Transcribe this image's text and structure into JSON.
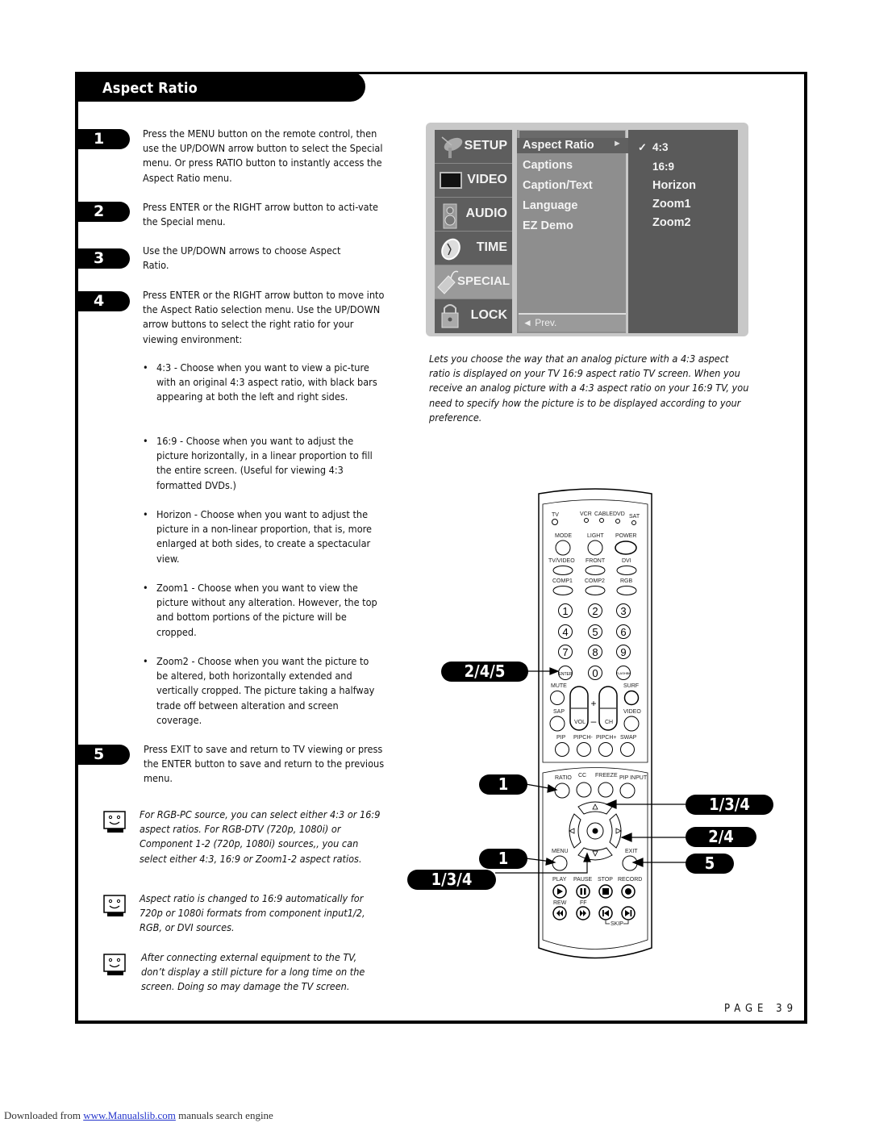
{
  "section_title": "Aspect Ratio",
  "steps": [
    {
      "number": "1",
      "text": "Press the MENU button on the remote control, then use the UP/DOWN arrow button to select the Special menu. Or press RATIO button to instantly access the Aspect Ratio menu."
    },
    {
      "number": "2",
      "text": "Press ENTER or the RIGHT arrow button to acti-vate the Special menu."
    },
    {
      "number": "3",
      "text": "Use the UP/DOWN arrows to choose Aspect Ratio."
    },
    {
      "number": "4",
      "text": "Press ENTER or the RIGHT arrow button to move into the Aspect Ratio selection menu. Use the UP/DOWN arrow buttons to select the right ratio for your viewing environment:"
    },
    {
      "number": "5",
      "text": "Press EXIT to save and return to TV viewing or press the ENTER button to save and return to the previous menu."
    }
  ],
  "bullets": [
    "4:3 - Choose when you want to view a pic-ture with an original 4:3 aspect ratio, with black bars appearing at both the left and right sides.",
    "16:9 - Choose when you want to adjust the picture horizontally, in a linear proportion to fill the entire screen. (Useful for viewing 4:3 formatted DVDs.)",
    "Horizon - Choose when you want to adjust the picture in a non-linear proportion, that is, more enlarged at both sides, to create a spectacular view.",
    "Zoom1 - Choose when you want to view the picture without any alteration. However, the top and bottom portions of the picture will be cropped.",
    "Zoom2 - Choose when you want the picture to be altered, both horizontally extended and vertically cropped. The picture taking a halfway trade off between alteration and screen coverage."
  ],
  "bullet_symbol": "•",
  "notes": [
    "For RGB-PC source, you can select either 4:3 or 16:9 aspect ratios. For RGB-DTV (720p, 1080i) or Component 1-2 (720p, 1080i) sources,, you can select either 4:3, 16:9 or Zoom1-2 aspect ratios.",
    "Aspect ratio is changed to 16:9 automatically for 720p or 1080i formats from component input1/2, RGB, or DVI sources.",
    "After connecting external equipment to the TV, don’t display a still picture for a long time on the screen. Doing so may damage the TV screen."
  ],
  "osd": {
    "main_menu": [
      {
        "label": "SETUP",
        "icon": "satellite-dish-icon"
      },
      {
        "label": "VIDEO",
        "icon": "tv-screen-icon"
      },
      {
        "label": "AUDIO",
        "icon": "speaker-icon"
      },
      {
        "label": "TIME",
        "icon": "clock-icon"
      },
      {
        "label": "SPECIAL",
        "icon": "tag-icon",
        "selected": true
      },
      {
        "label": "LOCK",
        "icon": "padlock-icon"
      }
    ],
    "submenu": [
      "Aspect Ratio",
      "Captions",
      "Caption/Text",
      "Language",
      "EZ Demo"
    ],
    "submenu_selected": "Aspect Ratio",
    "submenu_arrow": "►",
    "prev_label": "◄ Prev.",
    "options": [
      "4:3",
      "16:9",
      "Horizon",
      "Zoom1",
      "Zoom2"
    ],
    "checked_option": "4:3",
    "check_mark": "✓"
  },
  "caption": "Lets you choose the way that an analog picture with a 4:3 aspect ratio is displayed on your TV 16:9 aspect ratio TV screen. When you receive an analog picture with a 4:3 aspect ratio on your 16:9 TV, you need to specify how the picture is to be displayed according to your preference.",
  "remote": {
    "modes": [
      "TV",
      "VCR",
      "CABLE",
      "DVD",
      "SAT"
    ],
    "row1": [
      "MODE",
      "LIGHT",
      "POWER"
    ],
    "row2": [
      "TV/VIDEO",
      "FRONT",
      "DVI"
    ],
    "row3": [
      "COMP1",
      "COMP2",
      "RGB"
    ],
    "digits": [
      "1",
      "2",
      "3",
      "4",
      "5",
      "6",
      "7",
      "8",
      "9",
      "ENTER",
      "0",
      "FLASHBK"
    ],
    "mute": "MUTE",
    "surf": "SURF",
    "sap": "SAP",
    "video": "VIDEO",
    "vol": "VOL",
    "ch": "CH",
    "plus": "+",
    "minus": "–",
    "pip_row": [
      "PIP",
      "PIPCH-",
      "PIPCH+",
      "SWAP"
    ],
    "func_row": [
      "RATIO",
      "CC",
      "FREEZE",
      "PIP INPUT"
    ],
    "menu": "MENU",
    "exit": "EXIT",
    "transport_row1": [
      "PLAY",
      "PAUSE",
      "STOP",
      "RECORD"
    ],
    "transport_row2": [
      "REW",
      "FF"
    ],
    "skip": "SKIP"
  },
  "callouts": {
    "enter": "2/4/5",
    "ratio": "1",
    "menu": "1",
    "down": "1/3/4",
    "up": "1/3/4",
    "right": "2/4",
    "exit": "5"
  },
  "page_label": "PAGE 39",
  "footer": {
    "prefix": "Downloaded from ",
    "link": "www.Manualslib.com",
    "suffix": " manuals search engine"
  }
}
